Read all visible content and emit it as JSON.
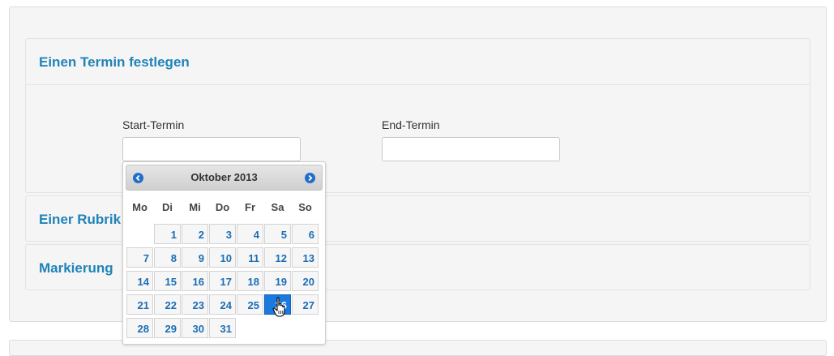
{
  "panels": [
    {
      "title": "Einen Termin festlegen"
    },
    {
      "title": "Einer Rubrik"
    },
    {
      "title": "Markierung"
    }
  ],
  "start_field": {
    "label": "Start-Termin",
    "value": "",
    "placeholder": ""
  },
  "end_field": {
    "label": "End-Termin",
    "value": "",
    "placeholder": ""
  },
  "datepicker": {
    "title": "Oktober 2013",
    "prev_icon": "chevron-left-icon",
    "next_icon": "chevron-right-icon",
    "weekdays": [
      "Mo",
      "Di",
      "Mi",
      "Do",
      "Fr",
      "Sa",
      "So"
    ],
    "days": [
      "1",
      "2",
      "3",
      "4",
      "5",
      "6",
      "7",
      "8",
      "9",
      "10",
      "11",
      "12",
      "13",
      "14",
      "15",
      "16",
      "17",
      "18",
      "19",
      "20",
      "21",
      "22",
      "23",
      "24",
      "25",
      "26",
      "27",
      "28",
      "29",
      "30",
      "31"
    ],
    "first_weekday_offset": 1,
    "active_day": "26",
    "colors": {
      "accent": "#1b7ae0",
      "link": "#1c6db5"
    }
  }
}
